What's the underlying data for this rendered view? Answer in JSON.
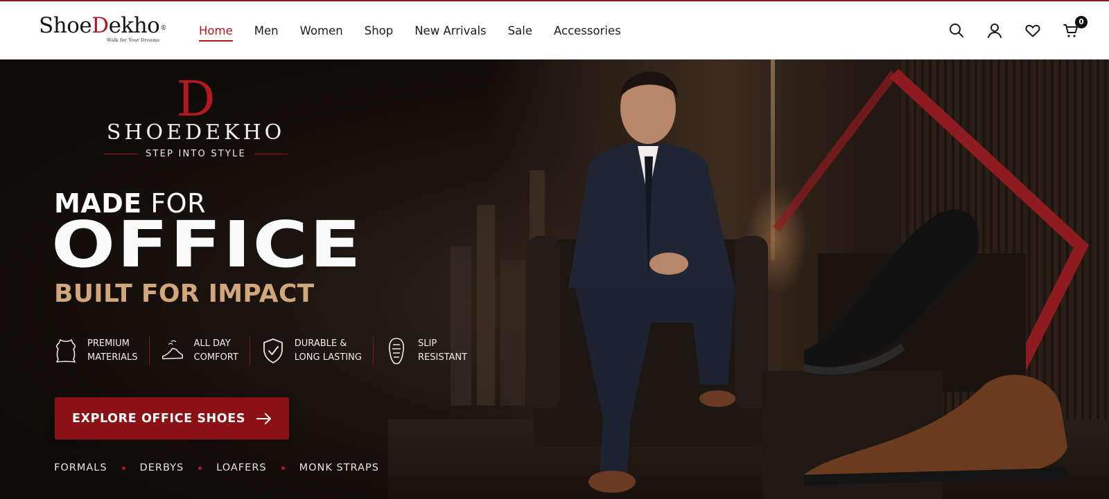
{
  "header": {
    "logo": {
      "part1": "Shoe",
      "part2": "D",
      "part3": "ekho",
      "mark": "®",
      "tagline": "Walk for Your Dreams"
    },
    "nav": [
      {
        "label": "Home",
        "active": true
      },
      {
        "label": "Men",
        "active": false
      },
      {
        "label": "Women",
        "active": false
      },
      {
        "label": "Shop",
        "active": false
      },
      {
        "label": "New Arrivals",
        "active": false
      },
      {
        "label": "Sale",
        "active": false
      },
      {
        "label": "Accessories",
        "active": false
      }
    ],
    "icons": [
      "search-icon",
      "user-icon",
      "heart-icon",
      "cart-icon"
    ],
    "cart_count": "0"
  },
  "hero": {
    "brand": {
      "letter": "D",
      "name": "SHOEDEKHO",
      "tagline": "STEP INTO STYLE"
    },
    "headline_made": "MADE",
    "headline_for": "FOR",
    "headline_main": "OFFICE",
    "headline_sub": "BUILT FOR IMPACT",
    "features": [
      {
        "icon": "leather-hide-icon",
        "text": "PREMIUM\nMATERIALS"
      },
      {
        "icon": "shoe-comfort-icon",
        "text": "ALL DAY\nCOMFORT"
      },
      {
        "icon": "shield-check-icon",
        "text": "DURABLE &\nLONG LASTING"
      },
      {
        "icon": "sole-grip-icon",
        "text": "SLIP\nRESISTANT"
      }
    ],
    "cta_label": "EXPLORE OFFICE SHOES",
    "categories": [
      "FORMALS",
      "DERBYS",
      "LOAFERS",
      "MONK STRAPS"
    ]
  },
  "colors": {
    "accent": "#b3171f",
    "cta": "#8c1116",
    "gold": "#d2a67b",
    "hero_bg": "#1b130e"
  }
}
